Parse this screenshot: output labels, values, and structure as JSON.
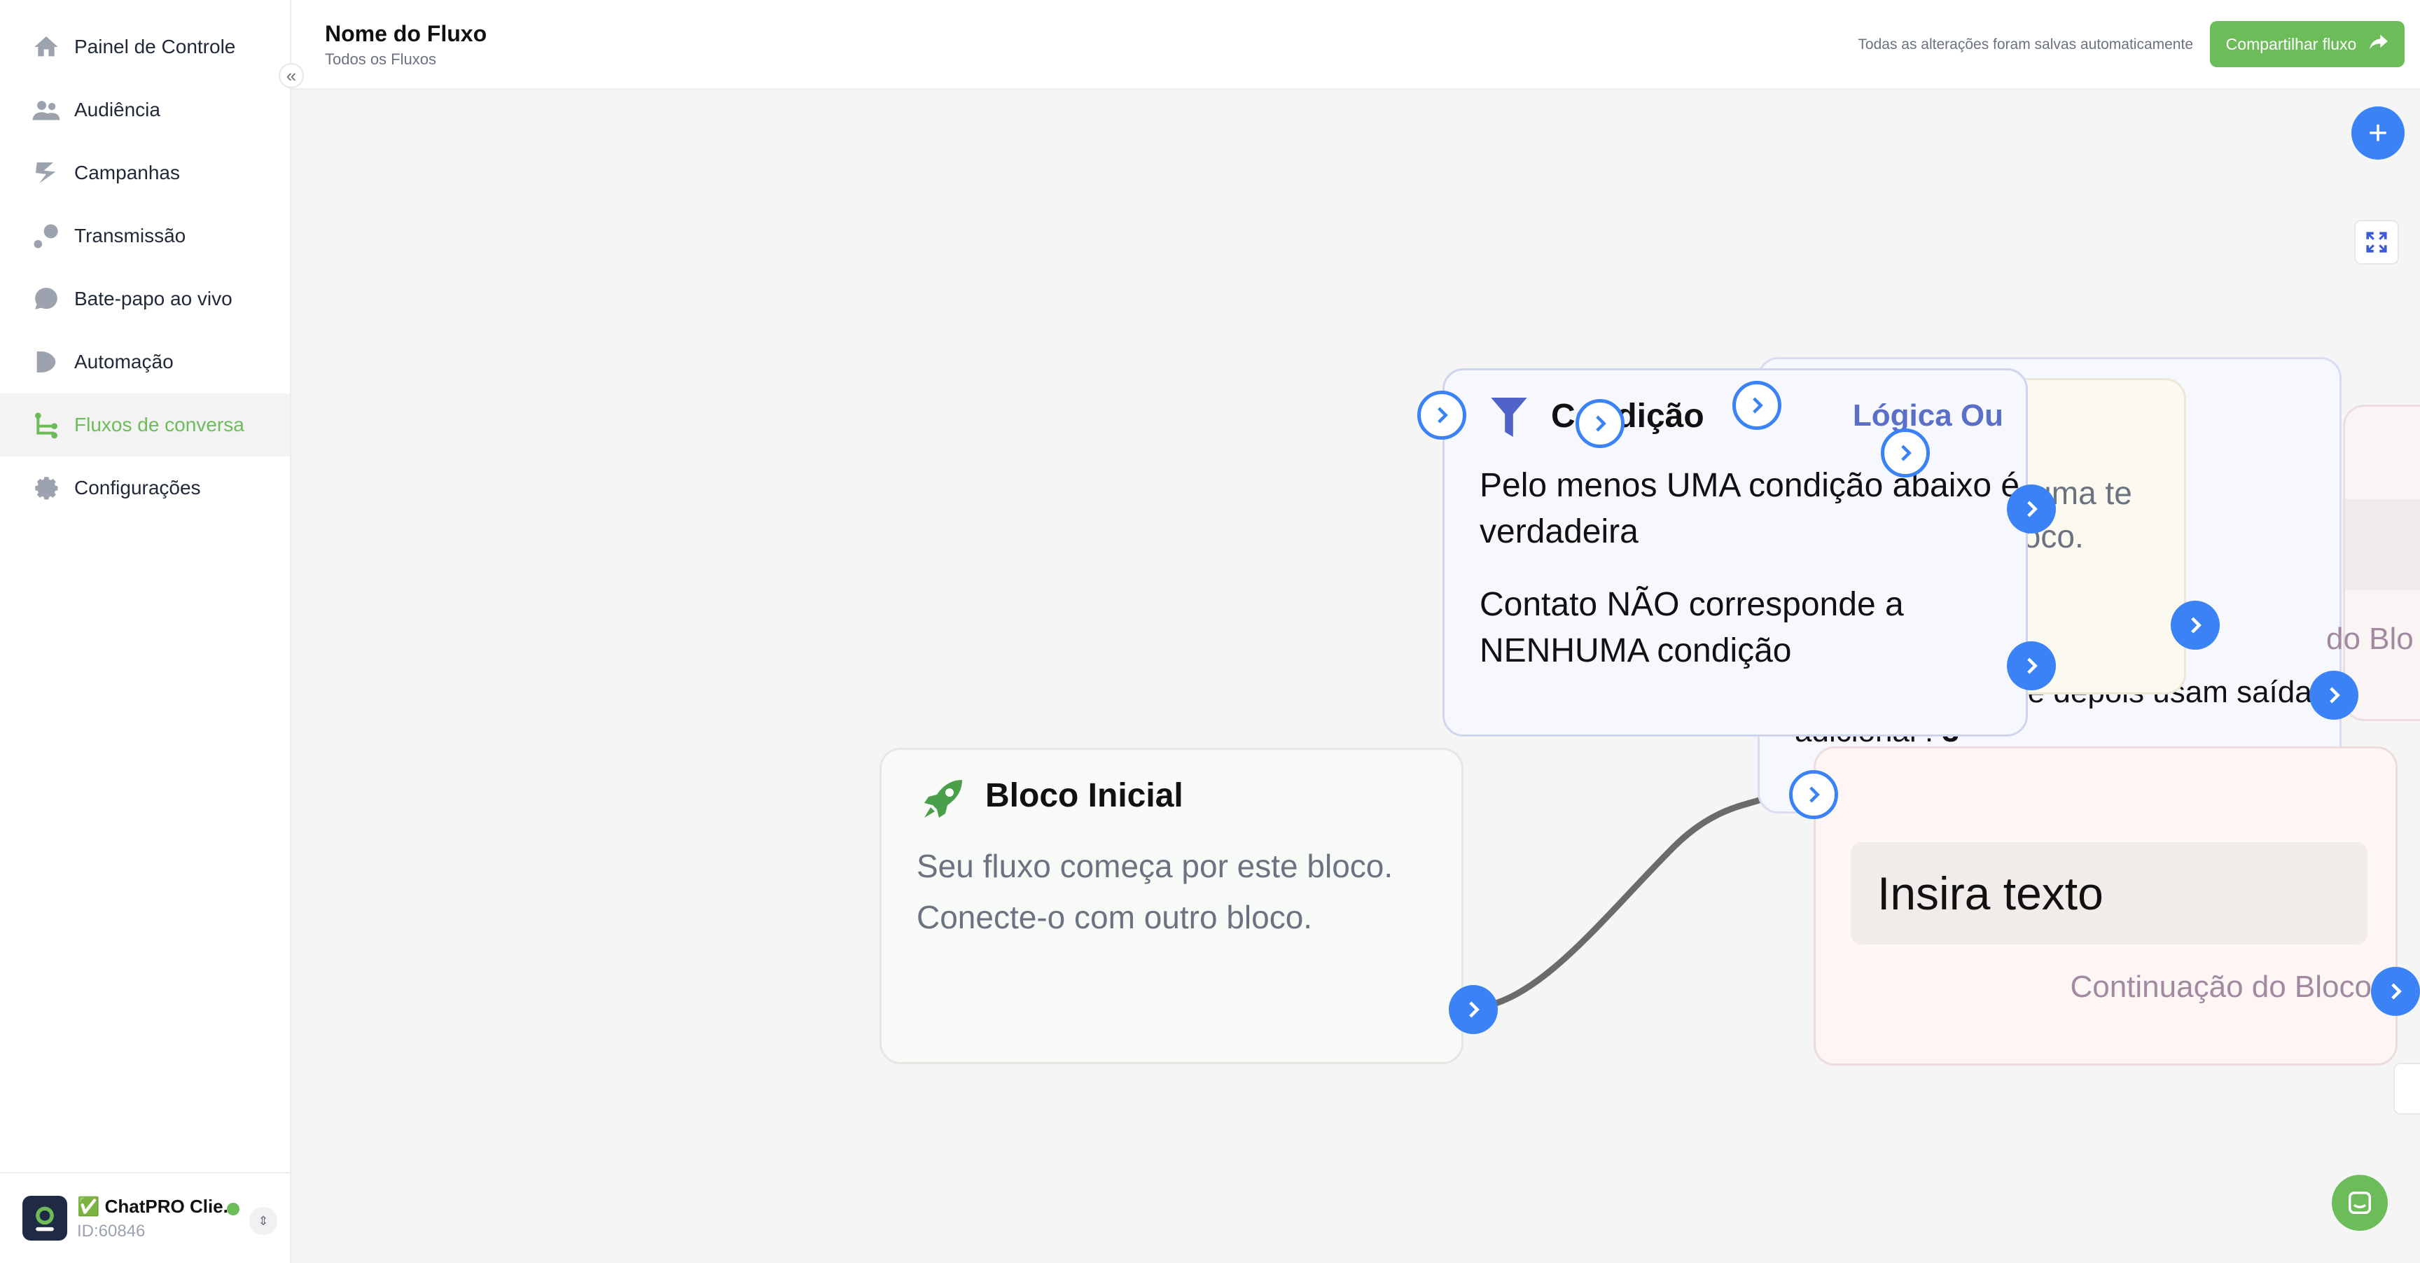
{
  "sidebar": {
    "items": [
      {
        "label": "Painel de Controle",
        "icon": "home-icon"
      },
      {
        "label": "Audiência",
        "icon": "users-icon"
      },
      {
        "label": "Campanhas",
        "icon": "campaigns-icon"
      },
      {
        "label": "Transmissão",
        "icon": "broadcast-icon"
      },
      {
        "label": "Bate-papo ao vivo",
        "icon": "chat-bubble-icon"
      },
      {
        "label": "Automação",
        "icon": "automation-icon"
      },
      {
        "label": "Fluxos de conversa",
        "icon": "flow-icon",
        "active": true
      },
      {
        "label": "Configurações",
        "icon": "gear-icon"
      }
    ],
    "collapse_icon": "double-chevron-left-icon",
    "account": {
      "name": "✅ ChatPRO Clie...",
      "id": "ID:60846",
      "avatar_text": "ChatPRO",
      "status_color": "#6cbd5a"
    }
  },
  "header": {
    "title": "Nome do Fluxo",
    "breadcrumb": "Todos os Fluxos",
    "autosave_text": "Todas as alterações foram salvas automaticamente",
    "share_label": "Compartilhar fluxo"
  },
  "canvas": {
    "start_block": {
      "title": "Bloco Inicial",
      "text": "Seu fluxo começa por este bloco. Conecte-o com outro bloco."
    },
    "condition_block": {
      "title": "Condição",
      "logic": "Lógica Ou",
      "line1": "Pelo menos UMA condição abaixo é verdadeira",
      "line2": "Contato NÃO corresponde a NENHUMA condição"
    },
    "back_block": {
      "text_visible": "uade de erros que depois usam saída adicional : ",
      "count": "3"
    },
    "yellow_block": {
      "text": "nhuma te bloco."
    },
    "right_fragment": "do Blo",
    "message_block": {
      "input_placeholder": "Insira texto",
      "continuation": "Continuação do Bloco"
    }
  },
  "colors": {
    "accent_green": "#6cbd5a",
    "port_blue": "#3b82f6",
    "logic_blue": "#5b6ec8"
  }
}
